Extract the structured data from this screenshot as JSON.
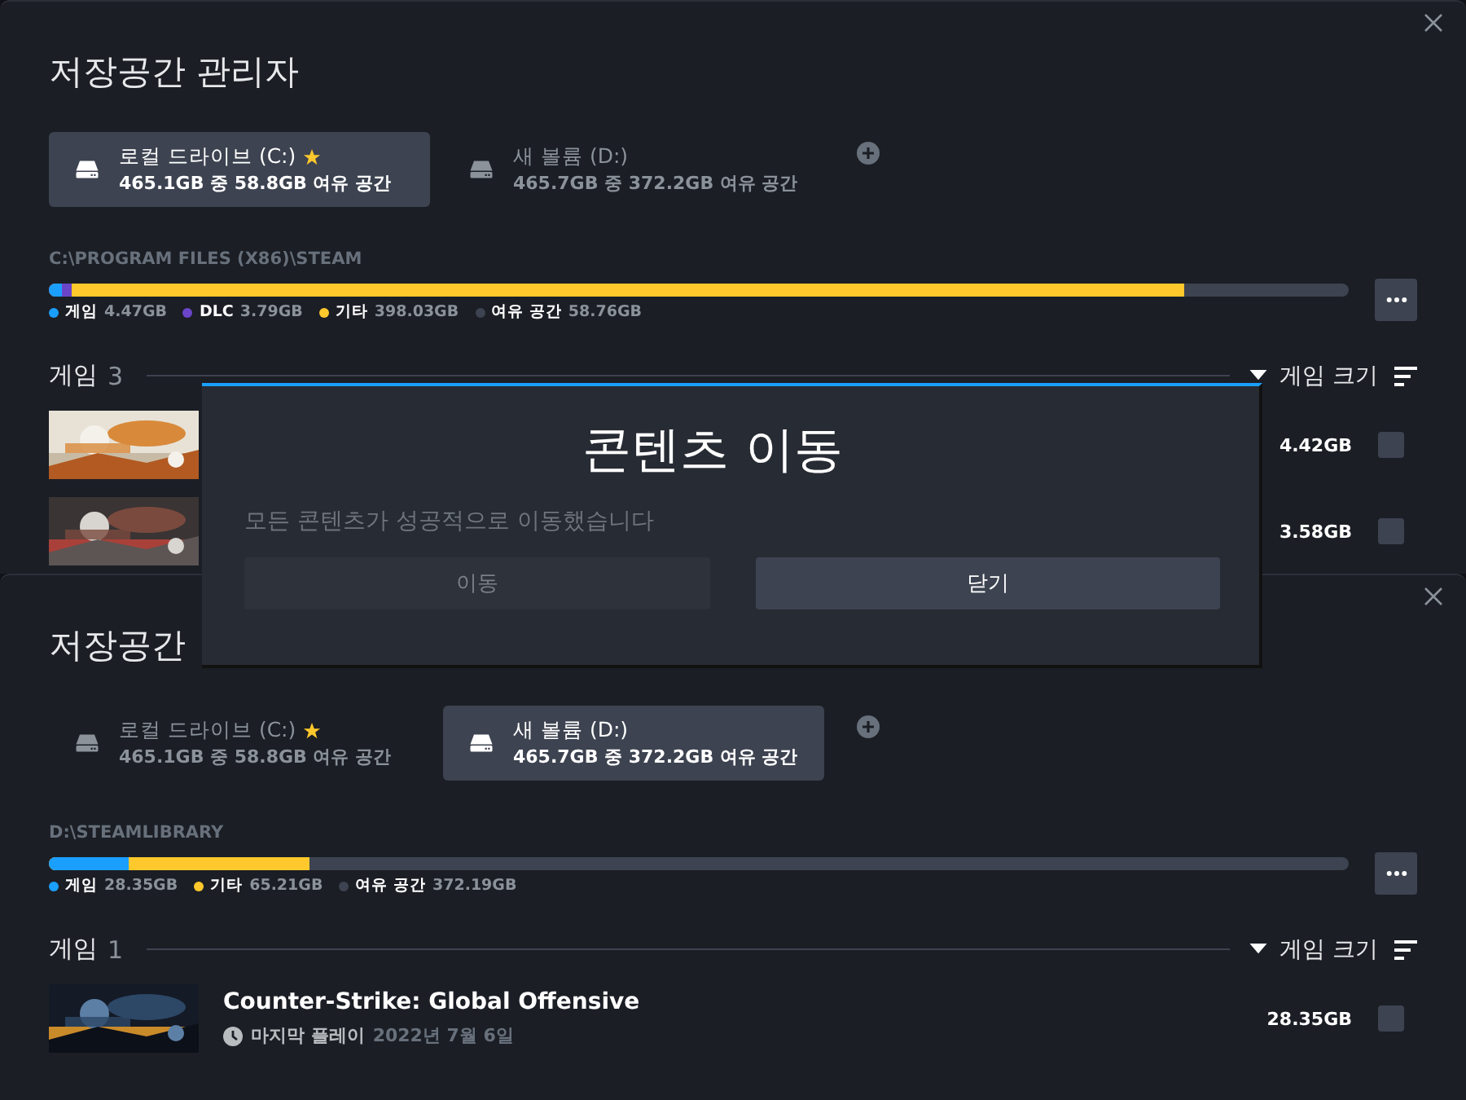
{
  "windows": [
    {
      "title": "저장공간 관리자",
      "drives": [
        {
          "name": "로컬 드라이브 (C:)",
          "starred": true,
          "capacity": "465.1GB 중 58.8GB 여유 공간",
          "selected": true
        },
        {
          "name": "새 볼륨 (D:)",
          "starred": false,
          "capacity": "465.7GB 중 372.2GB 여유 공간",
          "selected": false
        }
      ],
      "path": "C:\\PROGRAM FILES (X86)\\STEAM",
      "usage": [
        {
          "label": "게임",
          "value": "4.47GB",
          "color": "#1a9fff",
          "level": 0.0096
        },
        {
          "label": "DLC",
          "value": "3.79GB",
          "color": "#6a45c8",
          "level": 0.0178
        },
        {
          "label": "기타",
          "value": "398.03GB",
          "color": "#ffc82c",
          "level": 0.8738
        },
        {
          "label": "여유 공간",
          "value": "58.76GB",
          "color": "#3d4350"
        }
      ],
      "games_header": {
        "label": "게임",
        "count": "3",
        "sort": "게임 크기"
      },
      "games": [
        {
          "size": "4.42GB",
          "checked": false
        },
        {
          "size": "3.58GB",
          "checked": false
        }
      ]
    },
    {
      "title": "저장공간",
      "drives": [
        {
          "name": "로컬 드라이브 (C:)",
          "starred": true,
          "capacity": "465.1GB 중 58.8GB 여유 공간",
          "selected": false
        },
        {
          "name": "새 볼륨 (D:)",
          "starred": false,
          "capacity": "465.7GB 중 372.2GB 여유 공간",
          "selected": true
        }
      ],
      "path": "D:\\STEAMLIBRARY",
      "usage": [
        {
          "label": "게임",
          "value": "28.35GB",
          "color": "#1a9fff",
          "level": 0.0609
        },
        {
          "label": "기타",
          "value": "65.21GB",
          "color": "#ffc82c",
          "level": 0.2009
        },
        {
          "label": "여유 공간",
          "value": "372.19GB",
          "color": "#3d4350"
        }
      ],
      "games_header": {
        "label": "게임",
        "count": "1",
        "sort": "게임 크기"
      },
      "games": [
        {
          "name": "Counter-Strike: Global Offensive",
          "last_played_label": "마지막 플레이",
          "last_played": "2022년 7월 6일",
          "size": "28.35GB",
          "checked": false
        }
      ]
    }
  ],
  "dialog": {
    "title": "콘텐츠 이동",
    "message": "모든 콘텐츠가 성공적으로 이동했습니다",
    "buttons": [
      {
        "label": "이동",
        "disabled": true
      },
      {
        "label": "닫기",
        "disabled": false
      }
    ]
  }
}
